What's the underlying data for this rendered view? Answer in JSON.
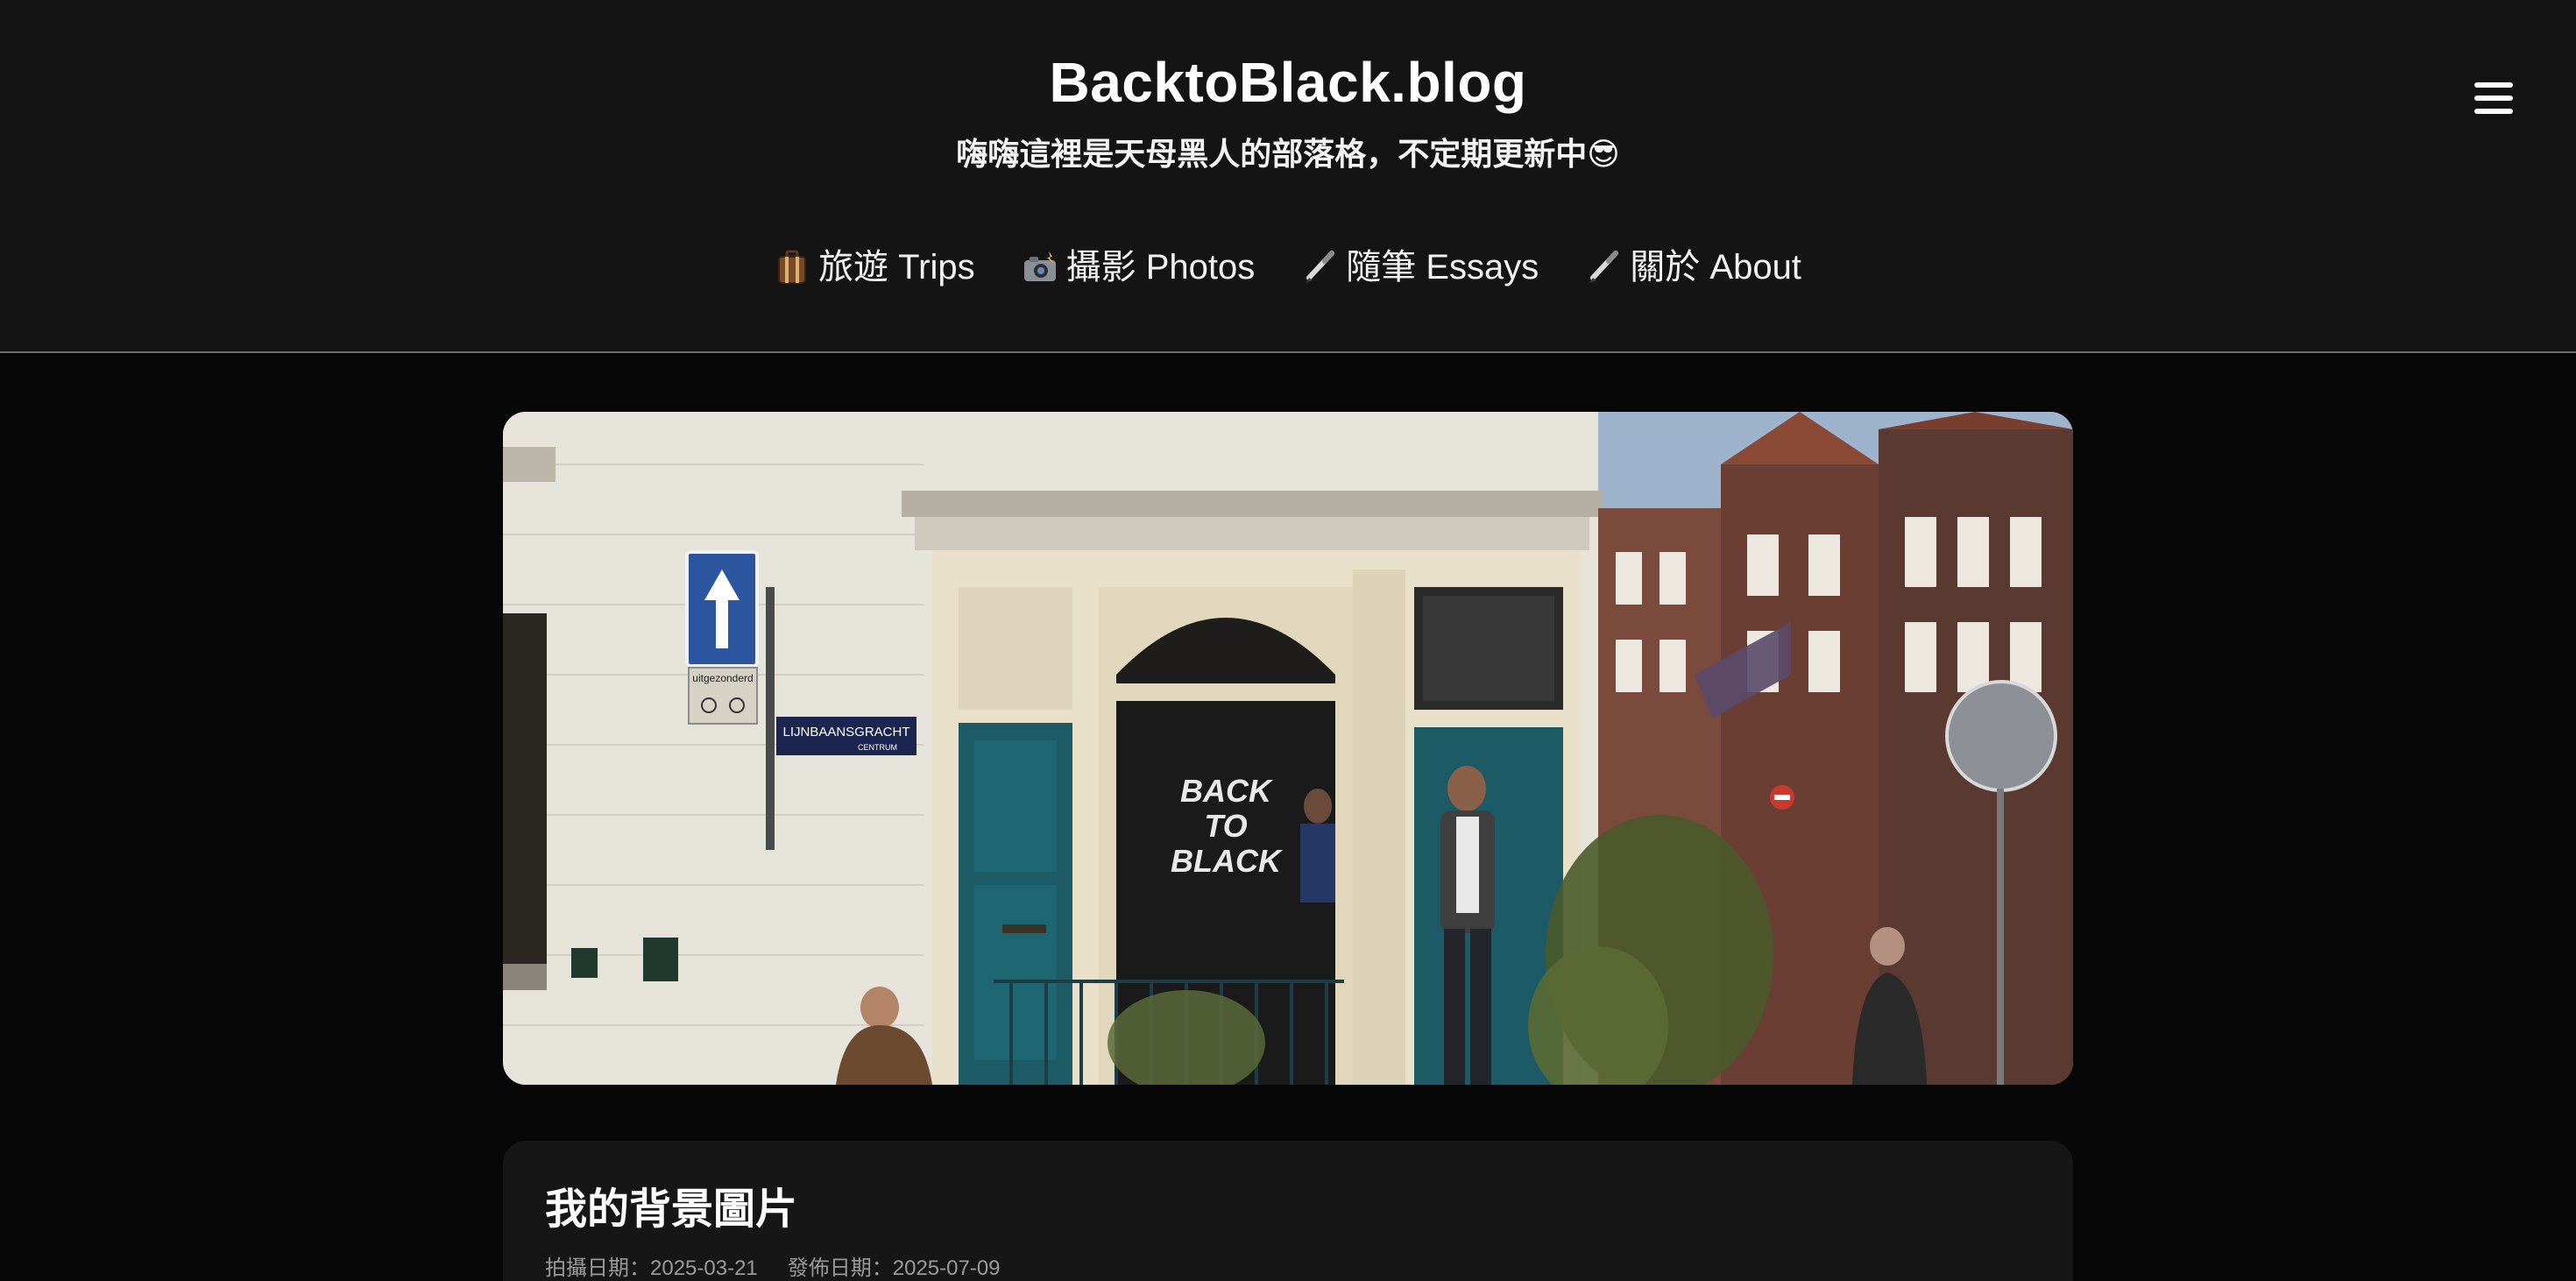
{
  "header": {
    "site_title": "BacktoBlack.blog",
    "tagline": "嗨嗨這裡是天母黑人的部落格，不定期更新中😎",
    "menu_icon": "hamburger-menu-icon"
  },
  "nav": {
    "items": [
      {
        "icon": "luggage-icon",
        "label": "旅遊 Trips"
      },
      {
        "icon": "camera-flash-icon",
        "label": "攝影 Photos"
      },
      {
        "icon": "pen-icon",
        "label": "隨筆 Essays"
      },
      {
        "icon": "pen-icon",
        "label": "關於 About"
      }
    ]
  },
  "hero": {
    "window_text_line1": "BACK",
    "window_text_line2": "TO",
    "window_text_line3": "BLACK",
    "street_sign": "LIJNBAANSGRACHT",
    "street_sign_sub": "CENTRUM",
    "sign_text": "uitgezonderd"
  },
  "post": {
    "title": "我的背景圖片",
    "shot_date": "拍攝日期：2025-03-21",
    "publish_date": "發佈日期：2025-07-09"
  },
  "colors": {
    "header_bg": "#141414",
    "page_bg": "#070707",
    "card_bg": "#161616",
    "door_teal": "#1c5a66"
  }
}
